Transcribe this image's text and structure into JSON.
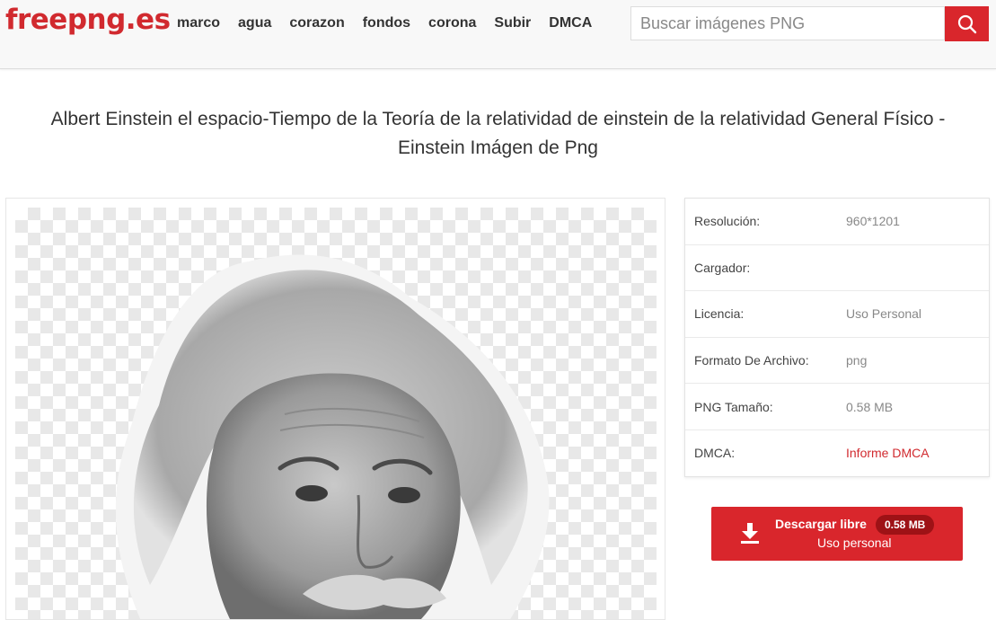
{
  "header": {
    "logo": "freepng.es",
    "nav": [
      "marco",
      "agua",
      "corazon",
      "fondos",
      "corona",
      "Subir",
      "DMCA"
    ],
    "search_placeholder": "Buscar imágenes PNG",
    "accent_color": "#d9262c"
  },
  "page_title": "Albert Einstein el espacio-Tiempo de la Teoría de la relatividad de einstein de la relatividad General Físico - Einstein Imágen de Png",
  "info": [
    {
      "label": "Resolución:",
      "value": "960*1201"
    },
    {
      "label": "Cargador:",
      "value": ""
    },
    {
      "label": "Licencia:",
      "value": "Uso Personal"
    },
    {
      "label": "Formato De Archivo:",
      "value": "png"
    },
    {
      "label": "PNG Tamaño:",
      "value": "0.58 MB"
    },
    {
      "label": "DMCA:",
      "value": "Informe DMCA"
    }
  ],
  "download": {
    "label": "Descargar libre",
    "size_badge": "0.58 MB",
    "sublabel": "Uso personal"
  }
}
